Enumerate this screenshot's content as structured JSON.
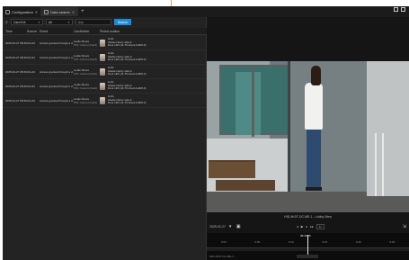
{
  "tabs": [
    {
      "label": "Configuration",
      "active": false
    },
    {
      "label": "Data search",
      "active": true
    }
  ],
  "filter": {
    "type_value": "Card Evt",
    "range_value": "All",
    "search_placeholder": "Any",
    "search_button": "Search"
  },
  "table": {
    "headers": [
      "Time",
      "Source",
      "Event",
      "Cardholder",
      "Photo",
      "Location"
    ],
    "rows": [
      {
        "time": "2025-02-27 08:46:06",
        "source": "UG-03",
        "event": "Access granted through a d...",
        "cardholder_name": "Leslie Moore",
        "cardholder_id": "PIN: Current (Card)",
        "loc1": "H-DL",
        "loc2": "Zweiter Entry side A",
        "loc3": "Door HID (11-75-cba-b-bd40f-3)"
      },
      {
        "time": "2025-02-27 08:46:05",
        "source": "UG-03",
        "event": "Access granted through a d...",
        "cardholder_name": "Leslie Moore",
        "cardholder_id": "PIN: Current (Card)",
        "loc1": "H-DL",
        "loc2": "Zweiter Entry side A",
        "loc3": "Door HID (11-75-cba-b-bd40f-3)"
      },
      {
        "time": "2025-02-27 08:46:05",
        "source": "UG-03",
        "event": "Access granted through a d...",
        "cardholder_name": "Leslie Moore",
        "cardholder_id": "PIN: Current (Card)",
        "loc1": "H-DL",
        "loc2": "Zweiter Entry side A",
        "loc3": "Door HID (11-75-cba-b-bd40f-3)"
      },
      {
        "time": "2025-02-27 08:46:06",
        "source": "UG-03",
        "event": "Access granted through a d...",
        "cardholder_name": "Leslie Moore",
        "cardholder_id": "PIN: Current (Card)",
        "loc1": "H-DL",
        "loc2": "Zweiter Entry side A",
        "loc3": "Door HID (11-75-cba-b-bd40f-3)"
      },
      {
        "time": "2025-02-27 08:46:05",
        "source": "UG-03",
        "event": "Access granted through a d...",
        "cardholder_name": "Leslie Moore",
        "cardholder_id": "PIN: Current (Card)",
        "loc1": "H-DL",
        "loc2": "Zweiter Entry side A",
        "loc3": "Door HID (11-75-cba-b-bd40f-3)"
      }
    ]
  },
  "video": {
    "caption": "HID-4K07-OC-ME-1 - Lobby View",
    "date": "2025-02-27",
    "speed": "1x",
    "tick_labels": [
      "9:00",
      "9:05",
      "9:10",
      "9:15",
      "9:20",
      "9:25"
    ],
    "cursor_time": "08:46:05",
    "timeline_label": "HID-4K07-OC-ME-1..."
  },
  "colors": {
    "accent": "#1e8ad8",
    "background": "#111111"
  }
}
